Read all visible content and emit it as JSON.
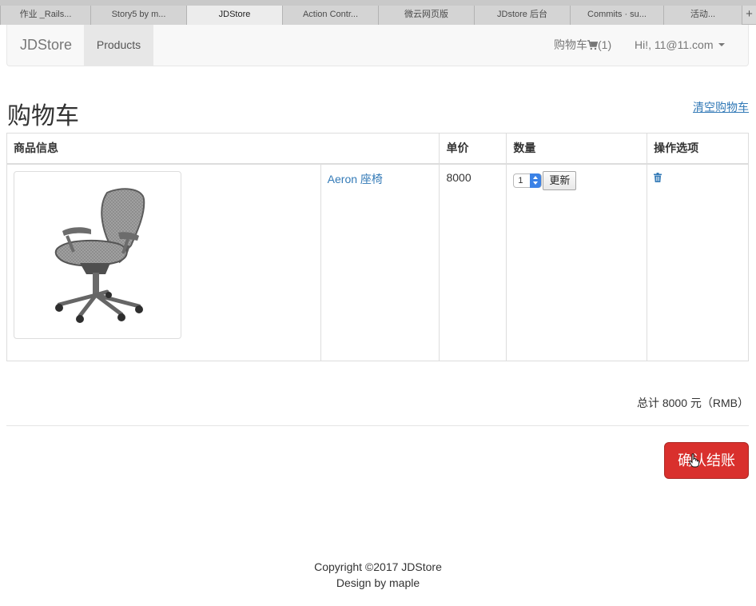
{
  "browser": {
    "tabs": [
      {
        "label": "作业 _Rails..."
      },
      {
        "label": "Story5 by m..."
      },
      {
        "label": "JDStore"
      },
      {
        "label": "Action Contr..."
      },
      {
        "label": "微云网页版"
      },
      {
        "label": "JDstore 后台"
      },
      {
        "label": "Commits · su..."
      },
      {
        "label": "活动..."
      }
    ],
    "new_tab": "+"
  },
  "navbar": {
    "brand": "JDStore",
    "products": "Products",
    "cart_label": "购物车",
    "cart_count": "(1)",
    "user": "Hi!, 11@11.com"
  },
  "page": {
    "title": "购物车",
    "clear_cart": "清空购物车"
  },
  "table": {
    "headers": [
      "商品信息",
      "单价",
      "数量",
      "操作选项"
    ],
    "rows": [
      {
        "product_name": "Aeron 座椅",
        "price": "8000",
        "quantity": "1",
        "update": "更新"
      }
    ]
  },
  "summary": {
    "total": "总计 8000 元（RMB）",
    "checkout": "确认结账"
  },
  "footer": {
    "copyright": "Copyright ©2017 JDStore",
    "design": "Design by maple"
  },
  "colors": {
    "link": "#337ab7",
    "danger": "#d9302d",
    "navbar_bg": "#f8f8f8"
  }
}
